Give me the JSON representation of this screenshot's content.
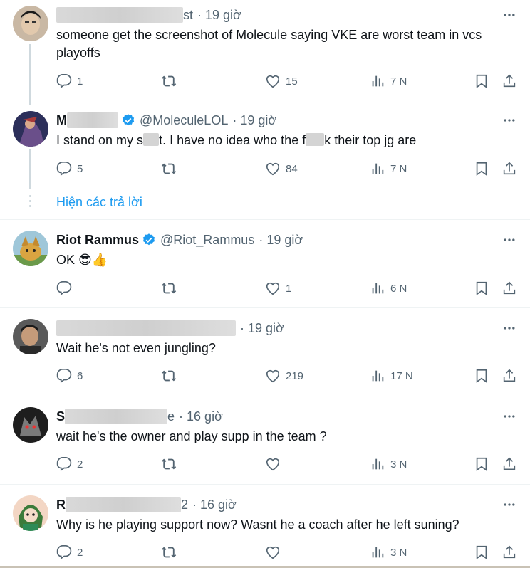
{
  "tweets": [
    {
      "name": "",
      "handle": "",
      "handle_tail": "st",
      "time": "19 giờ",
      "verified": false,
      "text": "someone get the screenshot of Molecule saying VKE are worst team in vcs playoffs",
      "replies": "1",
      "likes": "15",
      "views": "7 N"
    },
    {
      "name": "M",
      "handle": "@MoleculeLOL",
      "time": "19 giờ",
      "verified": true,
      "text_parts": [
        "I stand on my s",
        "t. I have no idea who the f",
        "k their top jg are"
      ],
      "replies": "5",
      "likes": "84",
      "views": "7 N"
    },
    {
      "name": "Riot Rammus",
      "handle": "@Riot_Rammus",
      "time": "19 giờ",
      "verified": true,
      "text": "OK 😎👍",
      "replies": "",
      "likes": "1",
      "views": "6 N"
    },
    {
      "name": "",
      "handle": "",
      "time": "19 giờ",
      "verified": false,
      "text": "Wait he's not even jungling?",
      "replies": "6",
      "likes": "219",
      "views": "17 N"
    },
    {
      "name": "S",
      "handle_tail": "e",
      "time": "16 giờ",
      "verified": false,
      "text": "wait he's the owner and play supp in the team ?",
      "replies": "2",
      "likes": "",
      "views": "3 N"
    },
    {
      "name": "R",
      "handle_tail": "2",
      "time": "16 giờ",
      "verified": false,
      "text": "Why is he playing support now? Wasnt he a coach after he left suning?",
      "replies": "2",
      "likes": "",
      "views": "3 N"
    }
  ],
  "show_replies_label": "Hiện các trả lời",
  "separator": "·",
  "colors": {
    "accent": "#1d9bf0",
    "muted": "#536471",
    "text": "#0f1419",
    "verified": "#1d9bf0"
  },
  "icons": [
    "reply-icon",
    "retweet-icon",
    "like-icon",
    "views-icon",
    "bookmark-icon",
    "share-icon",
    "more-icon",
    "verified-icon"
  ]
}
